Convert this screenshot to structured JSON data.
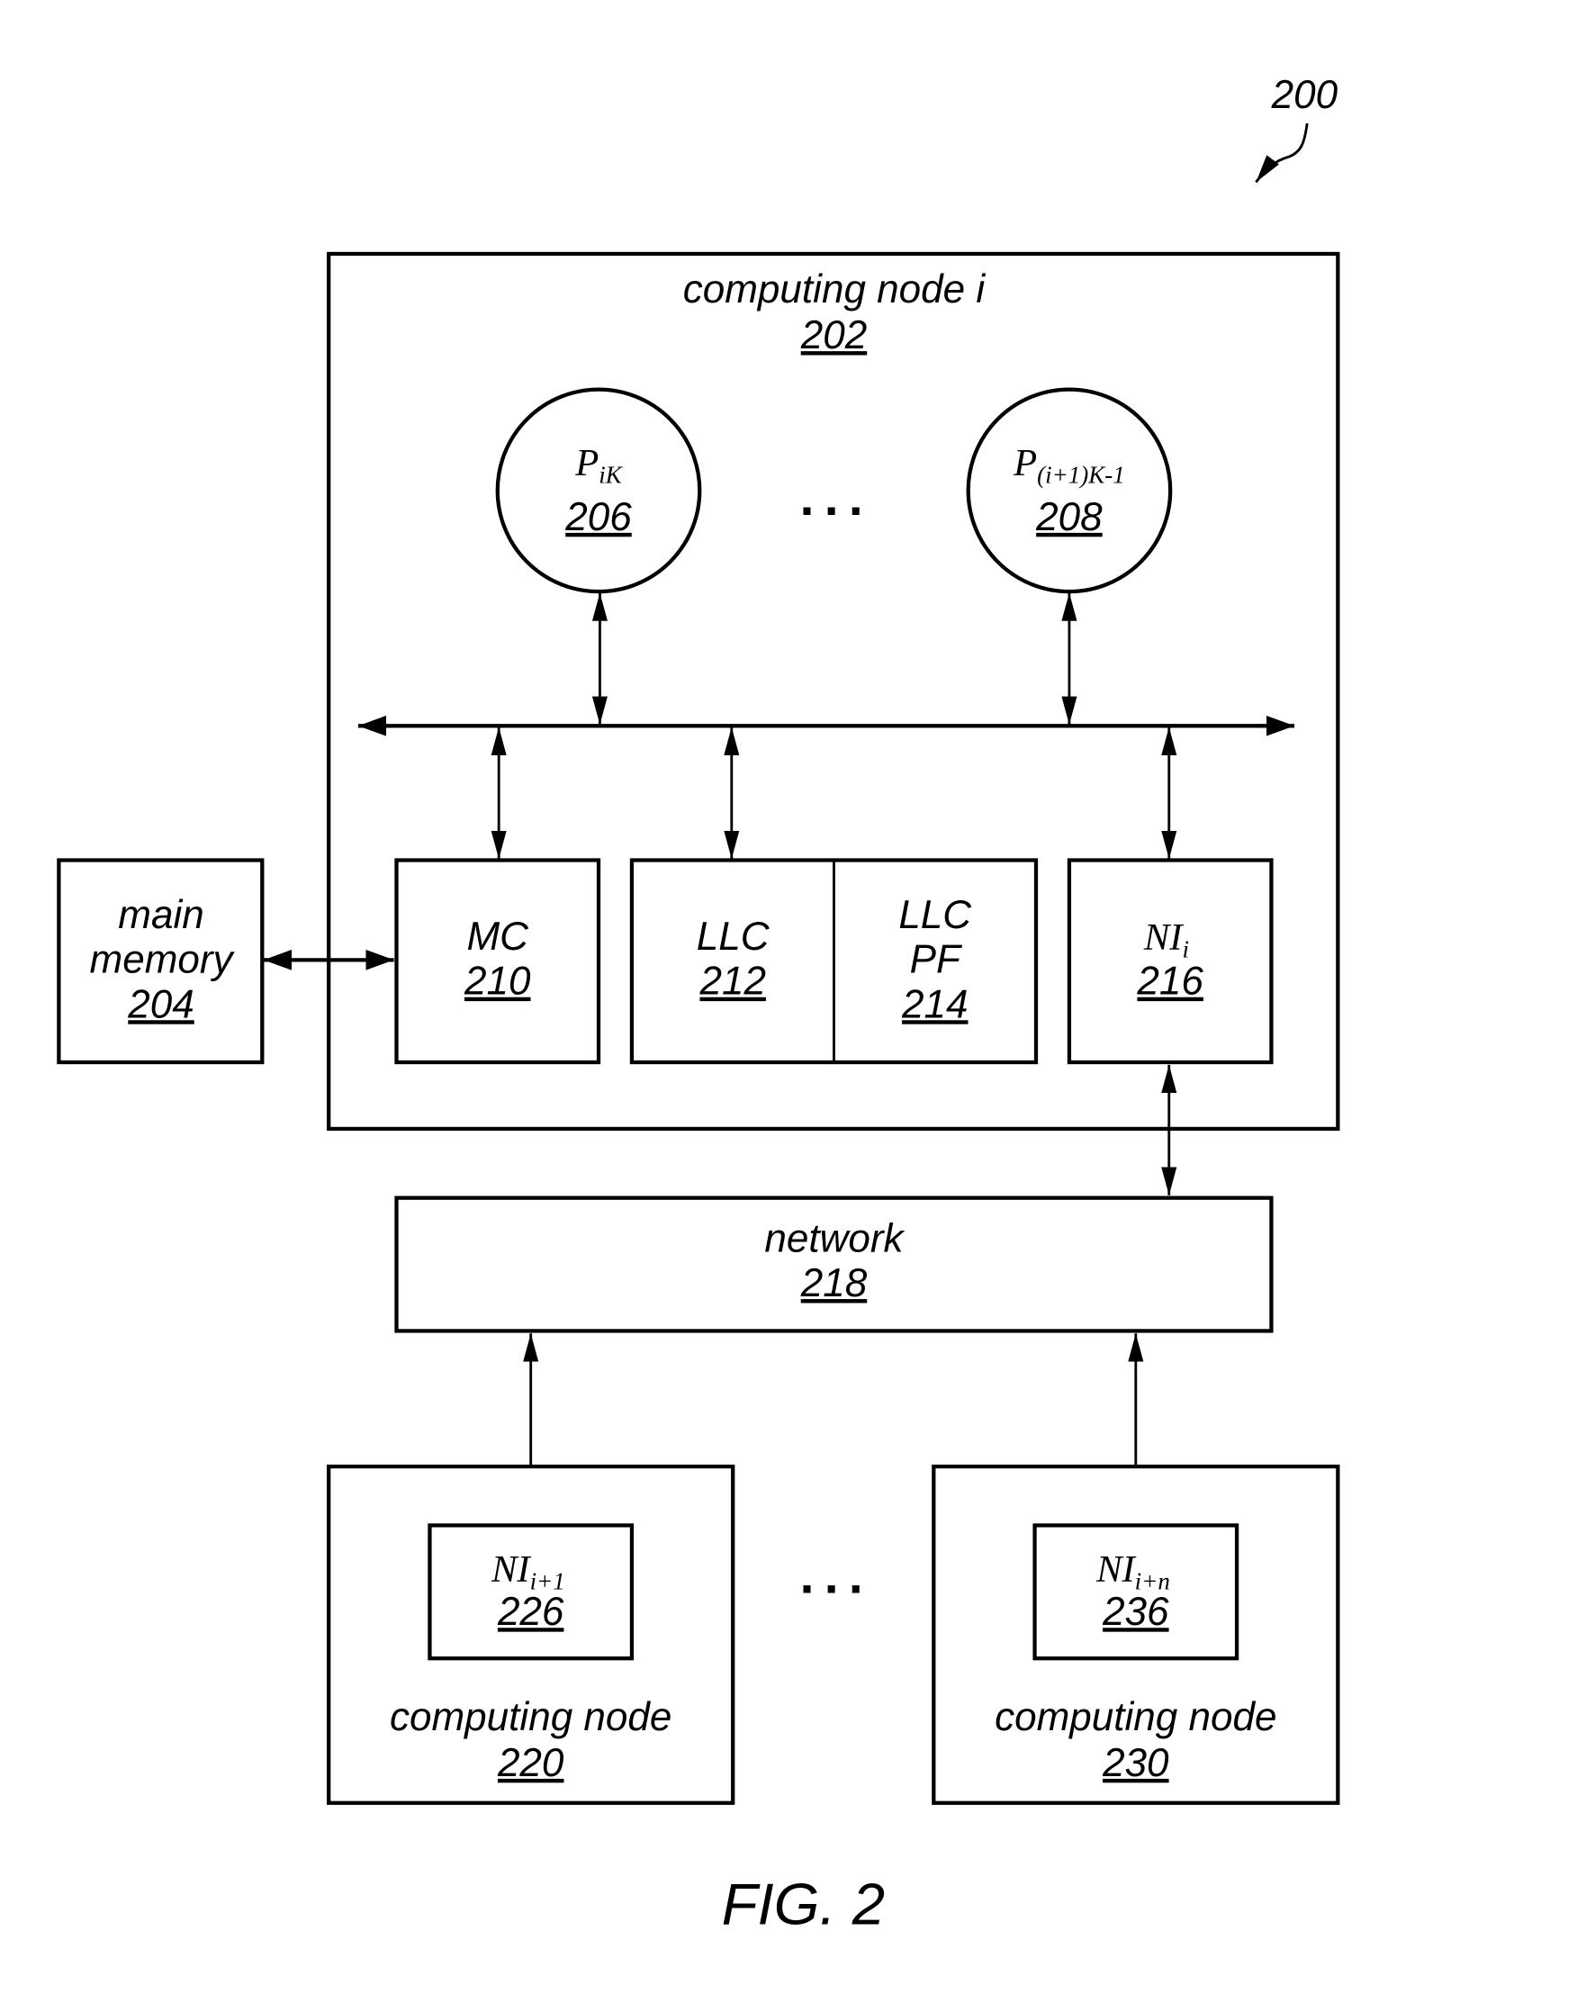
{
  "figure": {
    "reference_numeral": "200",
    "caption": "FIG. 2",
    "ellipsis": "..."
  },
  "computing_node_i": {
    "label": "computing node i",
    "number": "202"
  },
  "processors": [
    {
      "base": "P",
      "subscript": "iK",
      "number": "206"
    },
    {
      "base": "P",
      "subscript": "(i+1)K-1",
      "number": "208"
    }
  ],
  "main_memory": {
    "line1": "main",
    "line2": "memory",
    "number": "204"
  },
  "mc": {
    "label": "MC",
    "number": "210"
  },
  "llc": {
    "label": "LLC",
    "number": "212"
  },
  "llc_pf": {
    "line1": "LLC",
    "line2": "PF",
    "number": "214"
  },
  "ni_i": {
    "base": "NI",
    "subscript": "i",
    "number": "216"
  },
  "network": {
    "label": "network",
    "number": "218"
  },
  "remote_nodes": [
    {
      "label": "computing node",
      "number": "220",
      "ni_base": "NI",
      "ni_subscript": "i+1",
      "ni_number": "226"
    },
    {
      "label": "computing node",
      "number": "230",
      "ni_base": "NI",
      "ni_subscript": "i+n",
      "ni_number": "236"
    }
  ]
}
